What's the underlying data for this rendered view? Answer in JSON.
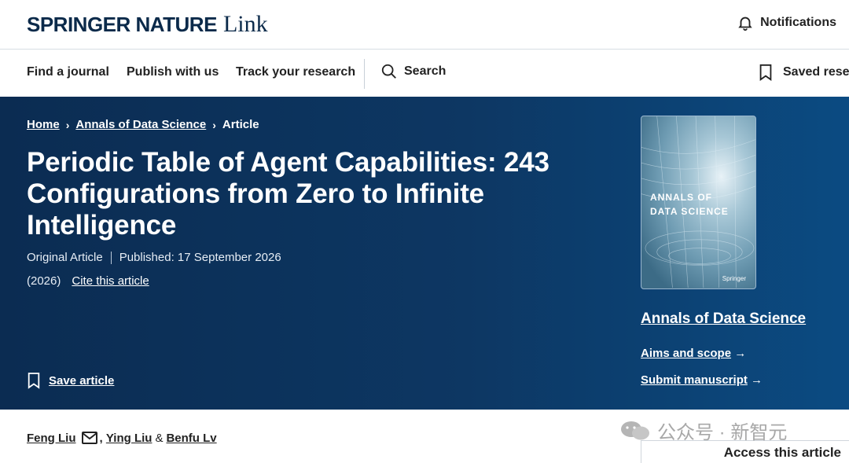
{
  "header": {
    "brand_main": "SPRINGER NATURE",
    "brand_sub": "Link",
    "notifications_label": "Notifications"
  },
  "nav": {
    "items": [
      "Find a journal",
      "Publish with us",
      "Track your research"
    ],
    "search_label": "Search",
    "saved_label": "Saved resea"
  },
  "hero": {
    "breadcrumb": [
      "Home",
      "Annals of Data Science",
      "Article"
    ],
    "title": "Periodic Table of Agent Capabilities: 243 Configurations from Zero to Infinite Intelligence",
    "article_type": "Original Article",
    "published": "Published: 17 September 2026",
    "year": "(2026)",
    "cite_label": "Cite this article",
    "save_label": "Save article"
  },
  "journal": {
    "cover_title_line1": "ANNALS OF",
    "cover_title_line2": "DATA SCIENCE",
    "cover_publisher": "Springer",
    "name": "Annals of Data Science",
    "aims_label": "Aims and scope",
    "submit_label": "Submit manuscript"
  },
  "authors": {
    "list": [
      "Feng Liu",
      "Ying Liu",
      "Benfu Lv"
    ],
    "and_symbol": "&"
  },
  "access": {
    "title": "Access this article"
  },
  "watermark": {
    "text": "公众号 · 新智元"
  },
  "colors": {
    "brand_navy": "#0b2a4a",
    "hero_start": "#0b2c52",
    "hero_end": "#0b4b82"
  }
}
